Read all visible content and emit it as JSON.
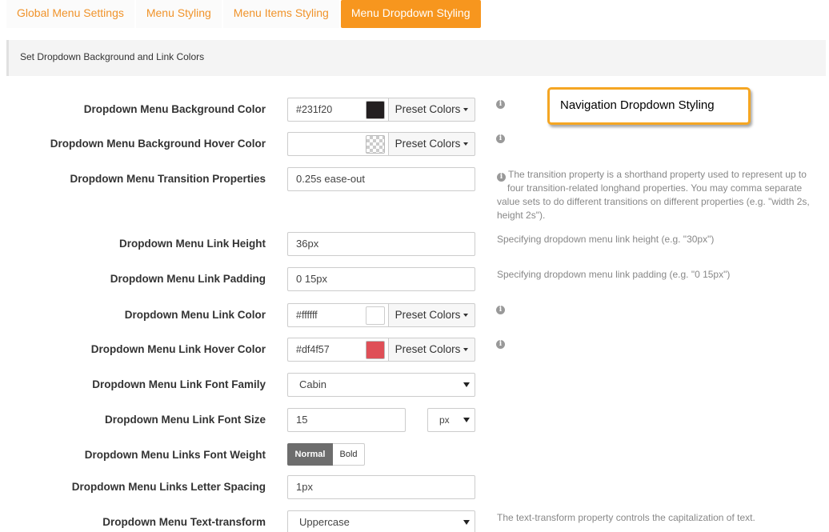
{
  "tabs": [
    {
      "label": "Global Menu Settings",
      "active": false
    },
    {
      "label": "Menu Styling",
      "active": false
    },
    {
      "label": "Menu Items Styling",
      "active": false
    },
    {
      "label": "Menu Dropdown Styling",
      "active": true
    }
  ],
  "section_title": "Set Dropdown Background and Link Colors",
  "callout": "Navigation Dropdown Styling",
  "preset_label": "Preset Colors",
  "fields": {
    "bg_color": {
      "label": "Dropdown Menu Background Color",
      "value": "#231f20",
      "swatch": "#231f20"
    },
    "bg_hover_color": {
      "label": "Dropdown Menu Background Hover Color",
      "value": "",
      "swatch": "transparent"
    },
    "transition": {
      "label": "Dropdown Menu Transition Properties",
      "value": "0.25s ease-out",
      "help": [
        "The transition property is a shorthand property used to represent up to",
        "four transition-related longhand properties. You may comma separate",
        "value sets to do different transitions on different properties (e.g. \"width 2s,",
        "height 2s\")."
      ]
    },
    "link_height": {
      "label": "Dropdown Menu Link Height",
      "value": "36px",
      "help": "Specifying dropdown menu link height (e.g. \"30px\")"
    },
    "link_padding": {
      "label": "Dropdown Menu Link Padding",
      "value": "0 15px",
      "help": "Specifying dropdown menu link padding (e.g. \"0 15px\")"
    },
    "link_color": {
      "label": "Dropdown Menu Link Color",
      "value": "#ffffff",
      "swatch": "#ffffff"
    },
    "link_hover_color": {
      "label": "Dropdown Menu Link Hover Color",
      "value": "#df4f57",
      "swatch": "#df4f57"
    },
    "font_family": {
      "label": "Dropdown Menu Link Font Family",
      "value": "Cabin"
    },
    "font_size": {
      "label": "Dropdown Menu Link Font Size",
      "value": "15",
      "unit": "px"
    },
    "font_weight": {
      "label": "Dropdown Menu Links Font Weight",
      "options": [
        "Normal",
        "Bold"
      ],
      "selected": "Normal"
    },
    "letter_spacing": {
      "label": "Dropdown Menu Links Letter Spacing",
      "value": "1px"
    },
    "text_transform": {
      "label": "Dropdown Menu Text-transform",
      "value": "Uppercase",
      "help": "The text-transform property controls the capitalization of text."
    }
  }
}
